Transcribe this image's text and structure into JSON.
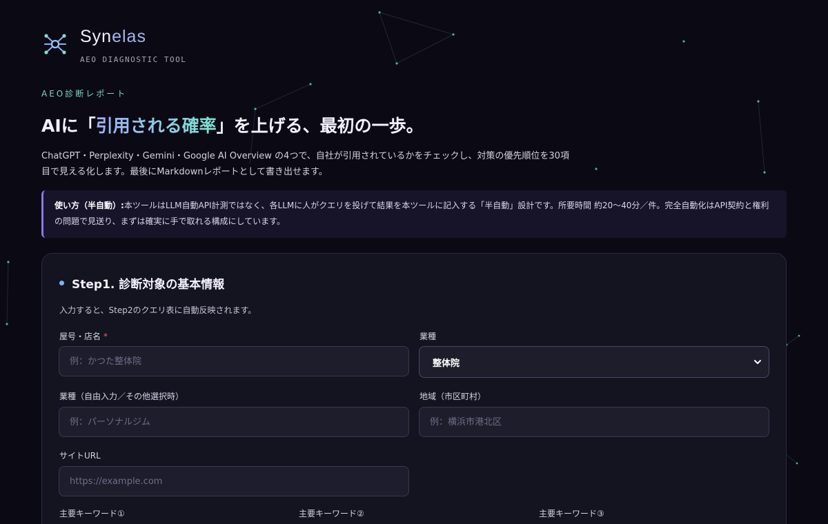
{
  "brand": {
    "name_prefix": "Syn",
    "name_suffix": "elas",
    "tagline": "AEO DIAGNOSTIC TOOL"
  },
  "hero": {
    "eyebrow": "AEO診断レポート",
    "headline_before": "AIに「",
    "headline_highlight": "引用される確率",
    "headline_after": "」を上げる、最初の一歩。",
    "lead": "ChatGPT・Perplexity・Gemini・Google AI Overview の4つで、自社が引用されているかをチェックし、対策の優先順位を30項目で見える化します。最後にMarkdownレポートとして書き出せます。"
  },
  "notice": {
    "label": "使い方（半自動）:",
    "text": "本ツールはLLM自動API計測ではなく、各LLMに人がクエリを投げて結果を本ツールに記入する「半自動」設計です。所要時間 約20〜40分／件。完全自動化はAPI契約と権利の問題で見送り、まずは確実に手で取れる構成にしています。"
  },
  "step1": {
    "title": "Step1. 診断対象の基本情報",
    "subtitle": "入力すると、Step2のクエリ表に自動反映されます。",
    "fields": {
      "shop_name": {
        "label": "屋号・店名",
        "required_mark": "*",
        "placeholder": "例：かつた整体院",
        "value": ""
      },
      "industry": {
        "label": "業種",
        "selected": "整体院"
      },
      "industry_free": {
        "label": "業種（自由入力／その他選択時）",
        "placeholder": "例：パーソナルジム",
        "value": ""
      },
      "region": {
        "label": "地域（市区町村）",
        "placeholder": "例：横浜市港北区",
        "value": ""
      },
      "site_url": {
        "label": "サイトURL",
        "placeholder": "https://example.com",
        "value": ""
      }
    },
    "keywords": {
      "kw1_label": "主要キーワード①",
      "kw2_label": "主要キーワード②",
      "kw3_label": "主要キーワード③"
    }
  },
  "colors": {
    "background": "#0b0a14",
    "accent_teal": "#79d6c7",
    "accent_violet": "#8a78e8",
    "required": "#ef5d6a"
  },
  "icons": {
    "brand": "network-node-icon",
    "select": "chevron-down-icon"
  }
}
